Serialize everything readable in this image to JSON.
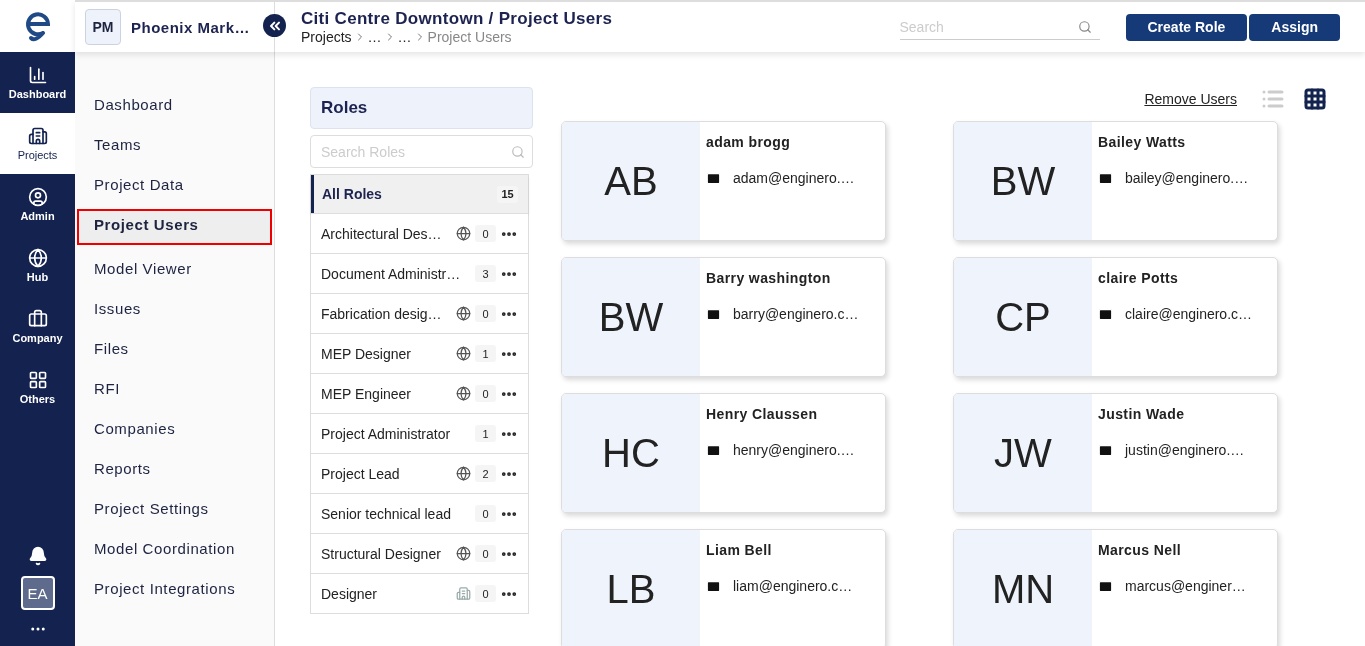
{
  "rail": {
    "items": [
      {
        "label": "Dashboard",
        "kind": "chart",
        "selected": false
      },
      {
        "label": "Projects",
        "kind": "building",
        "selected": true
      },
      {
        "label": "Admin",
        "kind": "user",
        "selected": false
      },
      {
        "label": "Hub",
        "kind": "hub",
        "selected": false
      },
      {
        "label": "Company",
        "kind": "company",
        "selected": false
      },
      {
        "label": "Others",
        "kind": "grid",
        "selected": false
      }
    ],
    "avatar": "EA"
  },
  "project": {
    "badge": "PM",
    "name": "Phoenix Mark…"
  },
  "header": {
    "title": "Citi Centre Downtown / Project Users",
    "breadcrumbs": [
      {
        "label": "Projects",
        "current": false
      },
      {
        "label": "…",
        "current": false
      },
      {
        "label": "…",
        "current": false
      },
      {
        "label": "Project Users",
        "current": true
      }
    ],
    "search": {
      "placeholder": "Search"
    },
    "buttons": [
      "Create Role",
      "Assign"
    ]
  },
  "sidebar": {
    "items": [
      {
        "label": "Dashboard",
        "selected": false
      },
      {
        "label": "Teams",
        "selected": false
      },
      {
        "label": "Project Data",
        "selected": false
      },
      {
        "label": "Project Users",
        "selected": true
      },
      {
        "label": "Model Viewer",
        "selected": false
      },
      {
        "label": "Issues",
        "selected": false
      },
      {
        "label": "Files",
        "selected": false
      },
      {
        "label": "RFI",
        "selected": false
      },
      {
        "label": "Companies",
        "selected": false
      },
      {
        "label": "Reports",
        "selected": false
      },
      {
        "label": "Project Settings",
        "selected": false
      },
      {
        "label": "Model Coordination",
        "selected": false
      },
      {
        "label": "Project Integrations",
        "selected": false
      }
    ]
  },
  "roles": {
    "title": "Roles",
    "search": {
      "placeholder": "Search Roles"
    },
    "all": {
      "label": "All Roles",
      "count": "15",
      "selected": true
    },
    "items": [
      {
        "name": "Architectural Des…",
        "kind": "hub",
        "count": "0"
      },
      {
        "name": "Document Administr…",
        "kind": "plain",
        "count": "3"
      },
      {
        "name": "Fabrication desig…",
        "kind": "hub",
        "count": "0"
      },
      {
        "name": "MEP Designer",
        "kind": "hub",
        "count": "1"
      },
      {
        "name": "MEP Engineer",
        "kind": "hub",
        "count": "0"
      },
      {
        "name": "Project Administrator",
        "kind": "plain",
        "count": "1"
      },
      {
        "name": "Project Lead",
        "kind": "hub",
        "count": "2"
      },
      {
        "name": "Senior technical lead",
        "kind": "plain",
        "count": "0"
      },
      {
        "name": "Structural Designer",
        "kind": "hub",
        "count": "0"
      },
      {
        "name": "Designer",
        "kind": "building",
        "count": "0"
      }
    ]
  },
  "users": {
    "remove": "Remove Users",
    "views": [
      {
        "kind": "list",
        "selected": false
      },
      {
        "kind": "grid",
        "selected": true
      }
    ],
    "items": [
      {
        "initials": "AB",
        "name": "adam brogg",
        "email": "adam@enginero.…"
      },
      {
        "initials": "BW",
        "name": "Bailey Watts",
        "email": "bailey@enginero.…"
      },
      {
        "initials": "BW",
        "name": "Barry washington",
        "email": "barry@enginero.c…"
      },
      {
        "initials": "CP",
        "name": "claire Potts",
        "email": "claire@enginero.c…"
      },
      {
        "initials": "HC",
        "name": "Henry Claussen",
        "email": "henry@enginero.…"
      },
      {
        "initials": "JW",
        "name": "Justin Wade",
        "email": "justin@enginero.…"
      },
      {
        "initials": "LB",
        "name": "Liam Bell",
        "email": "liam@enginero.c…"
      },
      {
        "initials": "MN",
        "name": "Marcus Nell",
        "email": "marcus@enginer…"
      }
    ]
  }
}
